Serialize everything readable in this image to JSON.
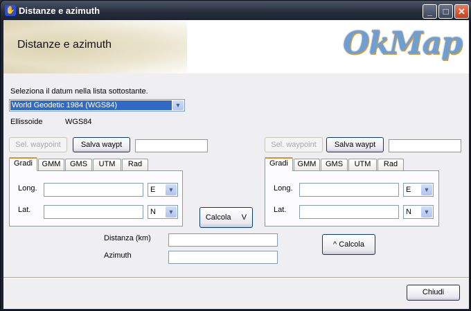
{
  "window": {
    "title": "Distanze e azimuth",
    "minimize": "_",
    "maximize": "□",
    "close": "✕"
  },
  "banner": {
    "title": "Distanze e azimuth",
    "logo": "OkMap"
  },
  "datum": {
    "label": "Seleziona il datum nella lista sottostante.",
    "selected": "World Geodetic 1984 (WGS84)"
  },
  "ellipsoid": {
    "label": "Ellissoide",
    "value": "WGS84"
  },
  "left": {
    "sel_waypoint": "Sel. waypoint",
    "save_waypoint": "Salva waypt",
    "waypoint_name": "",
    "tabs": [
      "Gradi",
      "GMM",
      "GMS",
      "UTM",
      "Rad"
    ],
    "long_label": "Long.",
    "long_value": "",
    "long_dir": "E",
    "lat_label": "Lat.",
    "lat_value": "",
    "lat_dir": "N"
  },
  "right": {
    "sel_waypoint": "Sel. waypoint",
    "save_waypoint": "Salva waypt",
    "waypoint_name": "",
    "tabs": [
      "Gradi",
      "GMM",
      "GMS",
      "UTM",
      "Rad"
    ],
    "long_label": "Long.",
    "long_value": "",
    "long_dir": "E",
    "lat_label": "Lat.",
    "lat_value": "",
    "lat_dir": "N"
  },
  "calc_down": "Calcola     V",
  "calc_up": "^ Calcola",
  "results": {
    "distance_label": "Distanza (km)",
    "distance_value": "",
    "azimuth_label": "Azimuth",
    "azimuth_value": ""
  },
  "close_button": "Chiudi"
}
